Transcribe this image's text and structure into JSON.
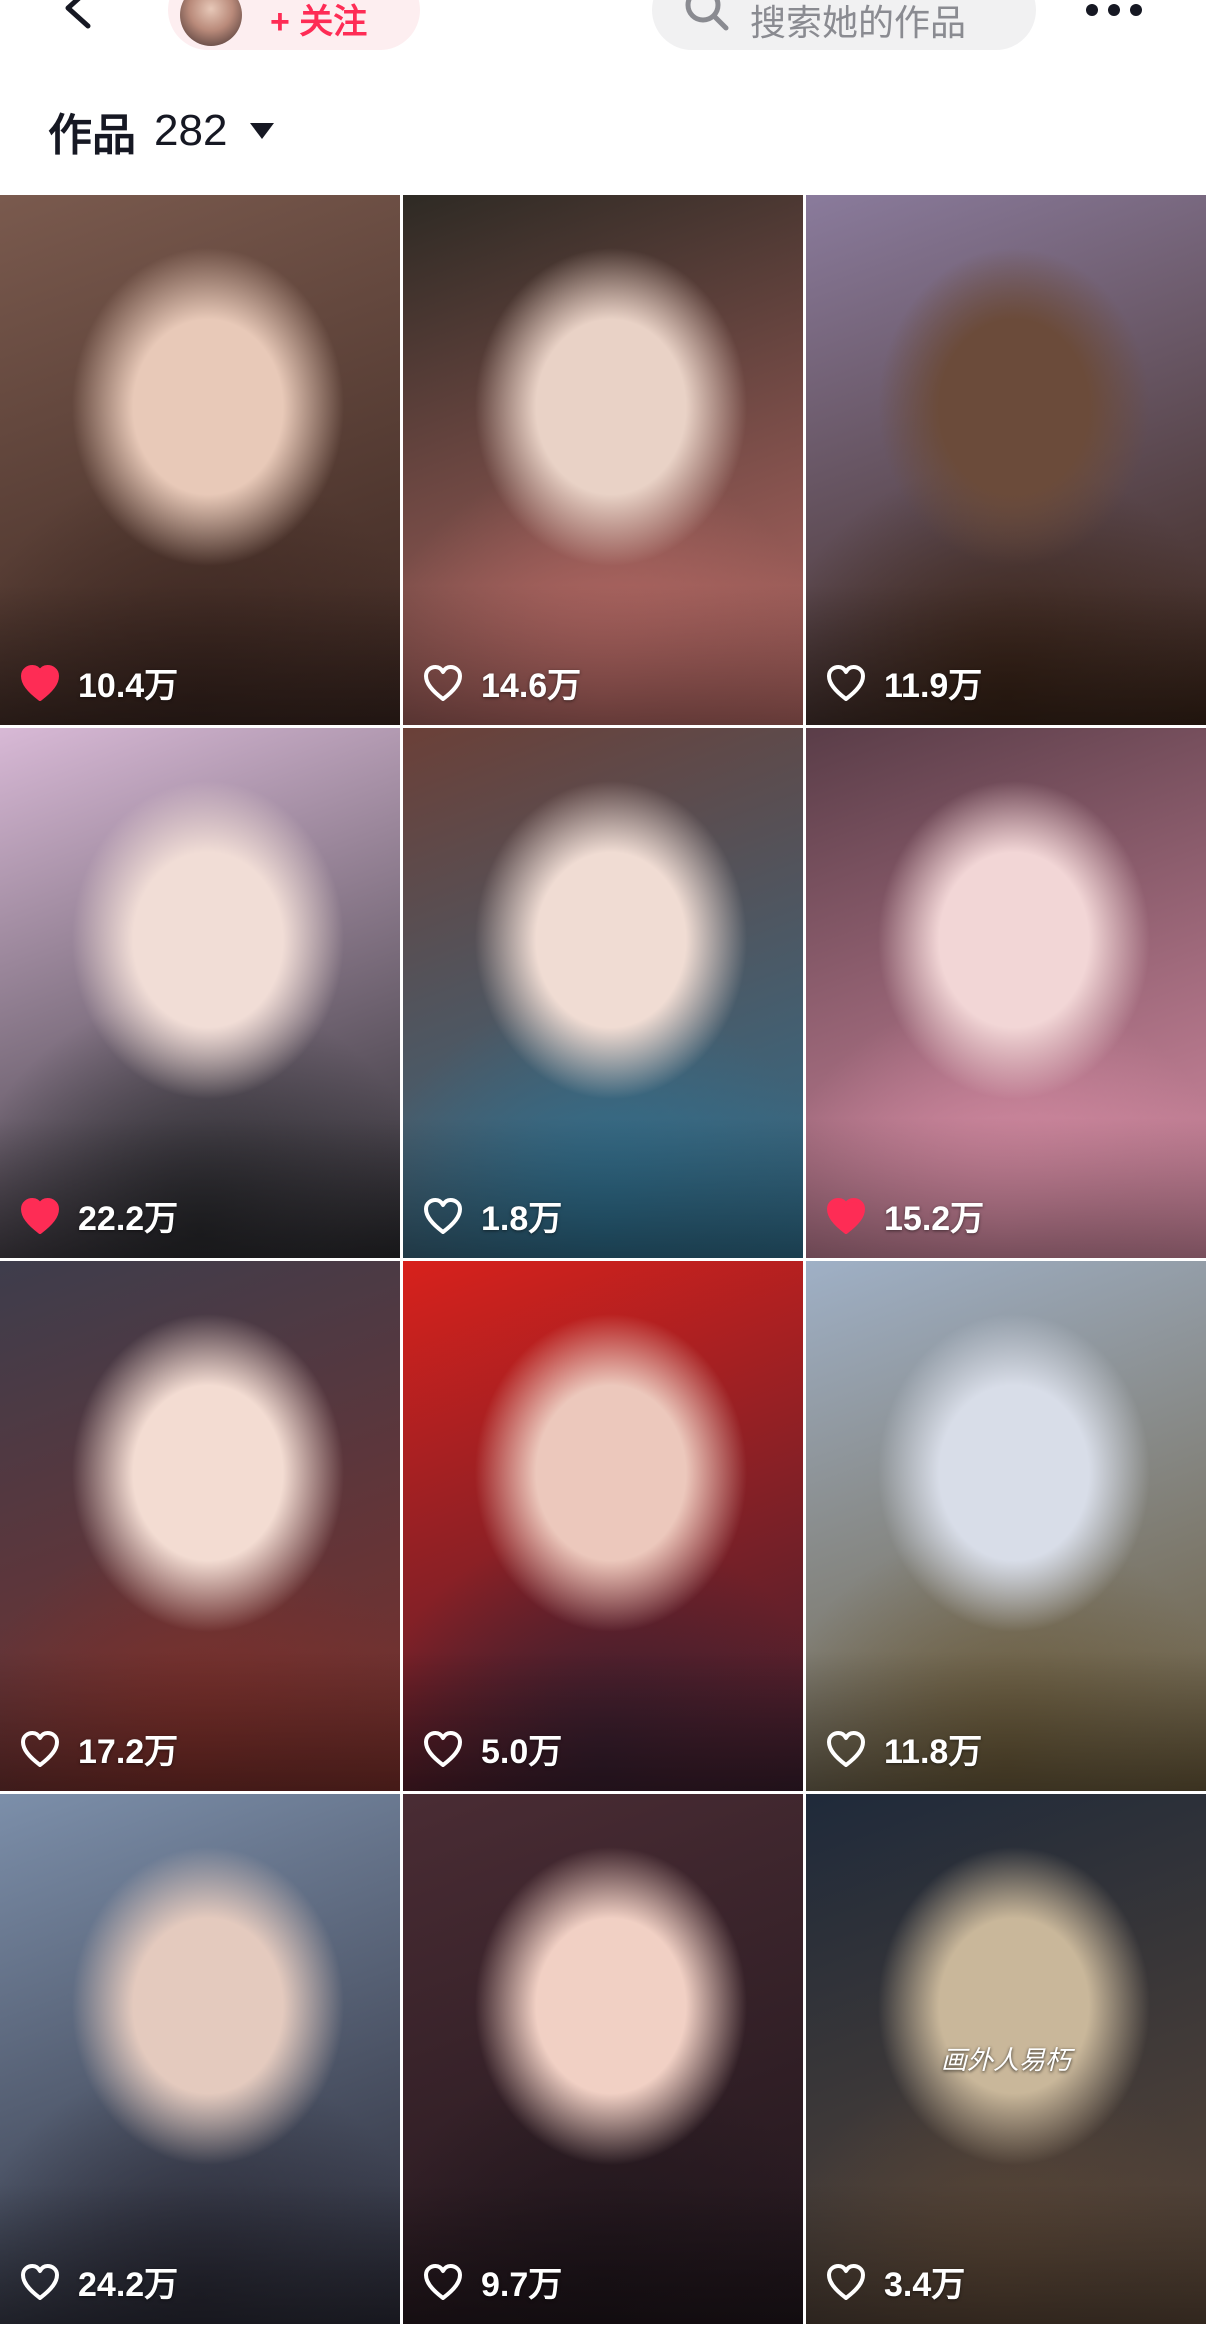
{
  "topbar": {
    "back_icon": "chevron-left-icon",
    "follow_label": "+ 关注",
    "search_placeholder": "搜索她的作品",
    "search_icon": "search-icon",
    "more_icon": "ellipsis-icon"
  },
  "works": {
    "label": "作品",
    "count": "282",
    "dropdown_icon": "caret-down-icon"
  },
  "videos": [
    {
      "likes": "10.4万",
      "liked": true,
      "bg": [
        "#7a5a4e",
        "#e8c9b8",
        "#3b2620"
      ]
    },
    {
      "likes": "14.6万",
      "liked": false,
      "bg": [
        "#2e2a24",
        "#e9d2c6",
        "#b86a66"
      ]
    },
    {
      "likes": "11.9万",
      "liked": false,
      "bg": [
        "#8a7b9c",
        "#6b4b3a",
        "#3a2418"
      ]
    },
    {
      "likes": "22.2万",
      "liked": true,
      "bg": [
        "#d8b9d6",
        "#f1ddd6",
        "#2a2a2e"
      ]
    },
    {
      "likes": "1.8万",
      "liked": false,
      "bg": [
        "#6b4038",
        "#f0dcd3",
        "#2f6f8e"
      ]
    },
    {
      "likes": "15.2万",
      "liked": true,
      "bg": [
        "#5a3d48",
        "#f2d6d6",
        "#d98ea6"
      ]
    },
    {
      "likes": "17.2万",
      "liked": false,
      "bg": [
        "#3e3d4c",
        "#f3dcd2",
        "#7c2f2a"
      ]
    },
    {
      "likes": "5.0万",
      "liked": false,
      "bg": [
        "#d8211c",
        "#ecc8bc",
        "#3a1f2f"
      ]
    },
    {
      "likes": "11.8万",
      "liked": false,
      "bg": [
        "#9fb0c6",
        "#d8dde8",
        "#6a5a3a"
      ]
    },
    {
      "likes": "24.2万",
      "liked": false,
      "bg": [
        "#7c8faa",
        "#e4cabe",
        "#2a2a36"
      ]
    },
    {
      "likes": "9.7万",
      "liked": false,
      "bg": [
        "#4a2c34",
        "#f1d0c4",
        "#20161c"
      ]
    },
    {
      "likes": "3.4万",
      "liked": false,
      "bg": [
        "#1f2a3a",
        "#c9b79a",
        "#5a4636"
      ],
      "caption": "画外人易朽"
    }
  ],
  "colors": {
    "accent": "#fe2c55",
    "liked_heart": "#fe2c55"
  }
}
